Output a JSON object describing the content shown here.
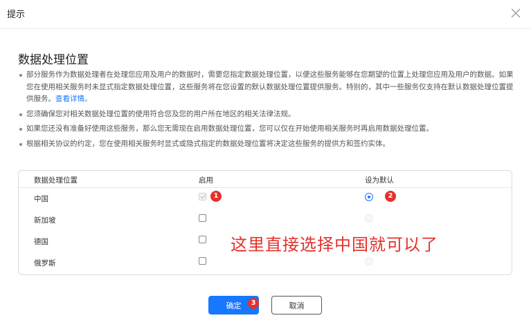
{
  "dialog": {
    "title": "提示",
    "close_icon": "close-icon"
  },
  "section_title": "数据处理位置",
  "notes": [
    {
      "text": "部分服务作为数据处理者在处理您应用及用户的数据时，需要您指定数据处理位置，以便这些服务能够在您期望的位置上处理您应用及用户的数据。如果您在使用相关服务时未显式指定数据处理位置，这些服务将在您设置的默认数据处理位置提供服务。特别的，其中一些服务仅支持在默认数据处理位置提供服务。",
      "link": "查看详情。"
    },
    {
      "text": "您须确保您对相关数据处理位置的使用符合您及您的用户所在地区的相关法律法规。"
    },
    {
      "text": "如果您还没有准备好使用这些服务，那么您无需现在启用数据处理位置，您可以仅在开始使用相关服务时再启用数据处理位置。"
    },
    {
      "text": "根据相关协议的约定，您在使用相关服务时显式或隐式指定的数据处理位置将决定这些服务的提供方和签约实体。"
    }
  ],
  "table": {
    "headers": [
      "数据处理位置",
      "启用",
      "设为默认"
    ],
    "rows": [
      {
        "name": "中国",
        "enabled": true,
        "enabled_disabled": true,
        "default": true
      },
      {
        "name": "新加坡",
        "enabled": false,
        "default": false
      },
      {
        "name": "德国",
        "enabled": false,
        "default": false
      },
      {
        "name": "俄罗斯",
        "enabled": false,
        "default": false
      }
    ]
  },
  "annotation": {
    "text": "这里直接选择中国就可以了",
    "badges": [
      "1",
      "2",
      "3"
    ],
    "color": "#e5302b"
  },
  "buttons": {
    "ok": "确定",
    "cancel": "取消"
  },
  "colors": {
    "accent": "#1677ff"
  }
}
